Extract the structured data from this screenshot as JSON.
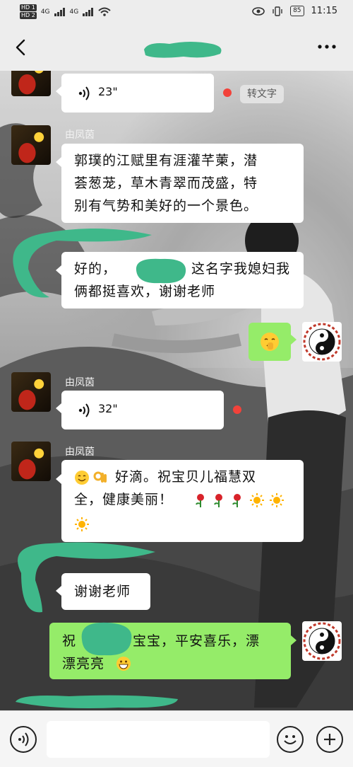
{
  "status_bar": {
    "hd1": "HD 1",
    "hd2": "HD 2",
    "net1": "4G",
    "net2": "4G",
    "battery": "85",
    "time": "11:15"
  },
  "nav": {
    "back_icon": "back-chevron-icon",
    "more_icon": "more-dots-icon"
  },
  "messages": [
    {
      "id": "voice1",
      "sender": "",
      "type": "voice",
      "duration": "23\"",
      "convert_label": "转文字"
    },
    {
      "id": "text1",
      "sender": "由凤茵",
      "type": "text",
      "line1": "郭璞的江赋里有涯灌芊萰，潜",
      "line2": "荟葱茏，草木青翠而茂盛，特",
      "line3": "别有气势和美好的一个景色。"
    },
    {
      "id": "text2",
      "sender": "",
      "type": "text",
      "line1": "好的，",
      "line1b": "这名字我媳妇我",
      "line2": "俩都挺喜欢，谢谢老师"
    },
    {
      "id": "voice2",
      "sender": "由凤茵",
      "type": "voice",
      "duration": "32\""
    },
    {
      "id": "text3",
      "sender": "由凤茵",
      "type": "text",
      "line1": "好滴。祝宝贝儿福慧双",
      "line2": "全，健康美丽！"
    },
    {
      "id": "text4",
      "sender": "",
      "type": "text",
      "line1": "谢谢老师"
    },
    {
      "id": "text5",
      "sender": "",
      "type": "text",
      "line1a": "祝",
      "line1b": "宝宝，平安喜乐，漂",
      "line2": "漂亮亮"
    }
  ],
  "colors": {
    "self_bubble": "#95ec69",
    "other_bubble": "#ffffff",
    "unread": "#f2423a",
    "redaction": "#3fb88a"
  },
  "bottom": {
    "voice_icon": "voice-mode-icon",
    "emoji_icon": "emoji-icon",
    "plus_icon": "plus-icon"
  }
}
